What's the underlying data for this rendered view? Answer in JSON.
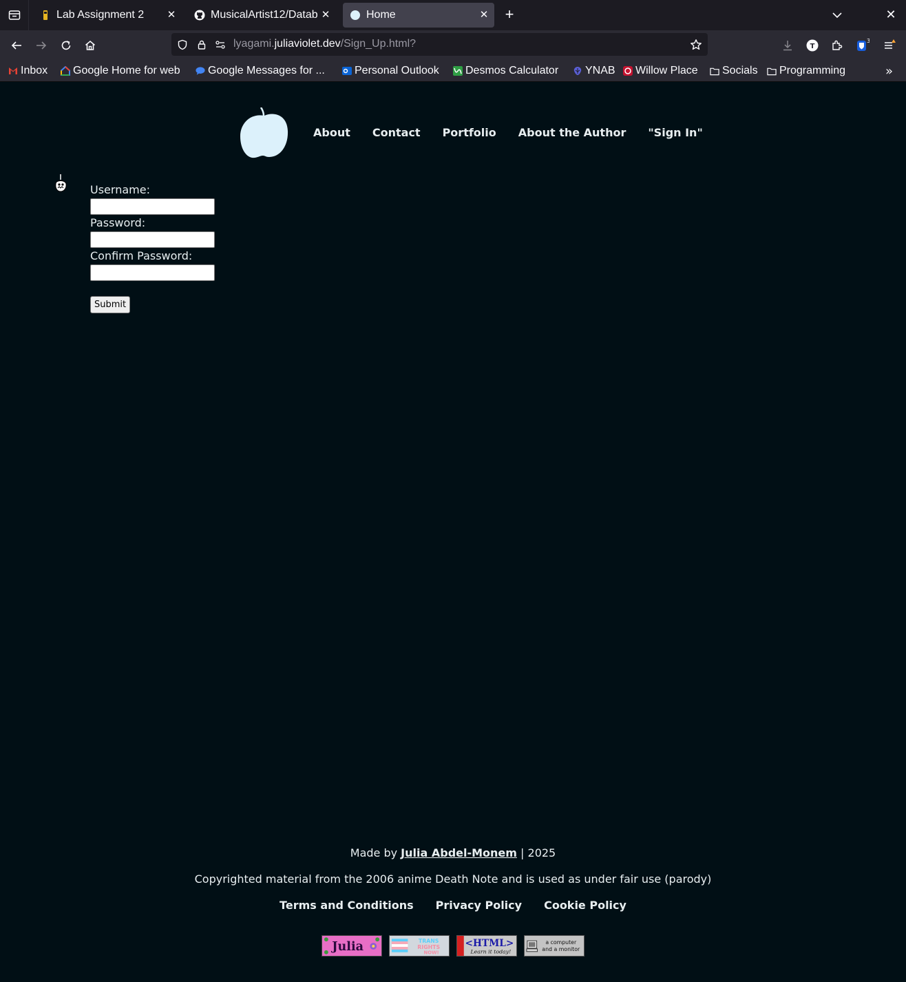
{
  "browser": {
    "tabs": [
      {
        "title": "Lab Assignment 2",
        "icon": "flag-icon",
        "active": false
      },
      {
        "title": "MusicalArtist12/Datab",
        "icon": "github-icon",
        "active": false
      },
      {
        "title": "Home",
        "icon": "circle-icon",
        "active": true
      }
    ],
    "url_prefix": "lyagami.",
    "url_host": "juliaviolet.dev",
    "url_path": "/Sign_Up.html?",
    "extension_badge": "3",
    "avatar_letter": "T",
    "bookmarks": [
      {
        "label": "Inbox",
        "icon": "gmail-icon",
        "color": "#ea4335"
      },
      {
        "label": "Google Home for web",
        "icon": "google-home-icon",
        "color": "#4285f4"
      },
      {
        "label": "Google Messages for ...",
        "icon": "messages-icon",
        "color": "#4285f4"
      },
      {
        "label": "Personal Outlook",
        "icon": "outlook-icon",
        "color": "#0a64d6"
      },
      {
        "label": "Desmos Calculator",
        "icon": "desmos-icon",
        "color": "#2f9e44"
      },
      {
        "label": "YNAB",
        "icon": "ynab-icon",
        "color": "#5a5fd6"
      },
      {
        "label": "Willow Place",
        "icon": "willow-icon",
        "color": "#c4122f"
      },
      {
        "label": "Socials",
        "icon": "folder-icon",
        "color": "#fbfbfe"
      },
      {
        "label": "Programming",
        "icon": "folder-icon",
        "color": "#fbfbfe"
      }
    ]
  },
  "site": {
    "nav": [
      "About",
      "Contact",
      "Portfolio",
      "About the Author",
      "\"Sign In\""
    ],
    "form": {
      "username_label": "Username:",
      "password_label": "Password:",
      "confirm_label": "Confirm Password:",
      "submit_label": "Submit"
    },
    "footer": {
      "made_prefix": "Made by ",
      "author": "Julia Abdel-Monem",
      "made_suffix": " | 2025",
      "copyright": "Copyrighted material from the 2006 anime Death Note and is used as under fair use (parody)",
      "legal": [
        "Terms and Conditions",
        "Privacy Policy",
        "Cookie Policy"
      ]
    },
    "badges": {
      "julia": "Julia",
      "trans_line1": "TRANS",
      "trans_line2": "RIGHTS",
      "trans_line3": "NOW!",
      "html_main": "<HTML>",
      "html_sub": "Learn it today!",
      "computer_line1": "a computer",
      "computer_line2": "and a monitor"
    }
  },
  "colors": {
    "page_bg": "#010f15",
    "logo": "#dcf1fb",
    "text": "#e8eef0"
  }
}
